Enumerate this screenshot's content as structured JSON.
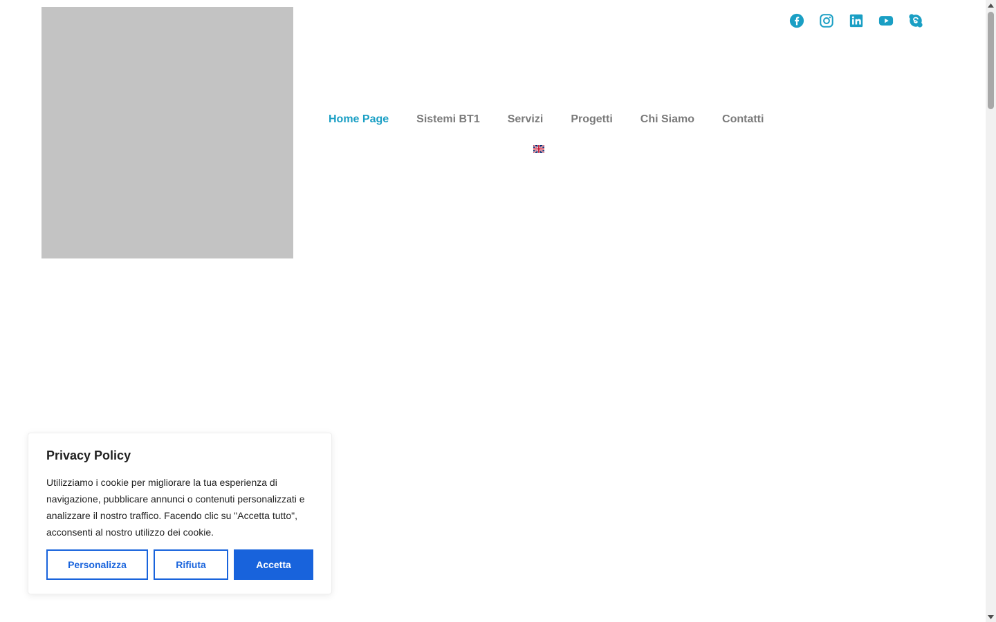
{
  "header": {
    "social_icons": [
      "facebook-icon",
      "instagram-icon",
      "linkedin-icon",
      "youtube-icon",
      "skype-icon"
    ],
    "social_color": "#1a9fc4"
  },
  "nav": {
    "active_color": "#1a9fc4",
    "items": [
      {
        "label": "Home Page",
        "active": true
      },
      {
        "label": "Sistemi BT1",
        "active": false
      },
      {
        "label": "Servizi",
        "active": false
      },
      {
        "label": "Progetti",
        "active": false
      },
      {
        "label": "Chi Siamo",
        "active": false
      },
      {
        "label": "Contatti",
        "active": false
      }
    ],
    "language_flag": "uk-flag-icon"
  },
  "cookie_banner": {
    "title": "Privacy Policy",
    "text": "Utilizziamo i cookie per migliorare la tua esperienza di navigazione, pubblicare annunci o contenuti personalizzati e analizzare il nostro traffico. Facendo clic su \"Accetta tutto\", acconsenti al nostro utilizzo dei cookie.",
    "customize_label": "Personalizza",
    "reject_label": "Rifiuta",
    "accept_label": "Accetta",
    "button_color": "#1863dc"
  }
}
